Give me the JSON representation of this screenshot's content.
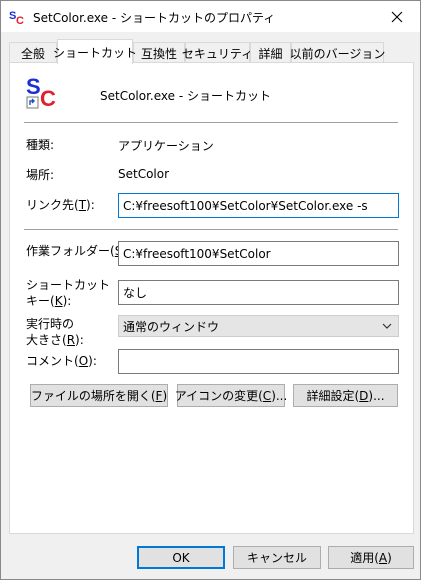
{
  "window": {
    "title": "SetColor.exe - ショートカットのプロパティ",
    "close_glyph": "close-icon"
  },
  "tabs": [
    {
      "label": "全般",
      "active": false
    },
    {
      "label": "ショートカット",
      "active": true
    },
    {
      "label": "互換性",
      "active": false
    },
    {
      "label": "セキュリティ",
      "active": false
    },
    {
      "label": "詳細",
      "active": false
    },
    {
      "label": "以前のバージョン",
      "active": false
    }
  ],
  "header": {
    "icon": "setcolor-app-icon",
    "title": "SetColor.exe - ショートカット"
  },
  "fields": {
    "type_label": "種類:",
    "type_value": "アプリケーション",
    "location_label": "場所:",
    "location_value": "SetColor",
    "target_label_pre": "リンク先(",
    "target_label_key": "T",
    "target_label_post": "):",
    "target_value": "C:¥freesoft100¥SetColor¥SetColor.exe -s",
    "startin_label_pre": "作業フォルダー(",
    "startin_label_key": "S",
    "startin_label_post": "):",
    "startin_value": "C:¥freesoft100¥SetColor",
    "hotkey_label_line1": "ショートカット",
    "hotkey_label_pre": "キー(",
    "hotkey_label_key": "K",
    "hotkey_label_post": "):",
    "hotkey_value": "なし",
    "run_label_line1": "実行時の",
    "run_label_pre": "大きさ(",
    "run_label_key": "R",
    "run_label_post": "):",
    "run_value": "通常のウィンドウ",
    "comment_label_pre": "コメント(",
    "comment_label_key": "O",
    "comment_label_post": "):",
    "comment_value": ""
  },
  "action_buttons": {
    "open_location_pre": "ファイルの場所を開く(",
    "open_location_key": "F",
    "open_location_post": ")",
    "change_icon_pre": "アイコンの変更(",
    "change_icon_key": "C",
    "change_icon_post": ")...",
    "advanced_pre": "詳細設定(",
    "advanced_key": "D",
    "advanced_post": ")..."
  },
  "footer": {
    "ok": "OK",
    "cancel": "キャンセル",
    "apply_pre": "適用(",
    "apply_key": "A",
    "apply_post": ")"
  },
  "colors": {
    "accent": "#0078d7",
    "icon_blue": "#1a2fd6",
    "icon_red": "#e0202a"
  }
}
